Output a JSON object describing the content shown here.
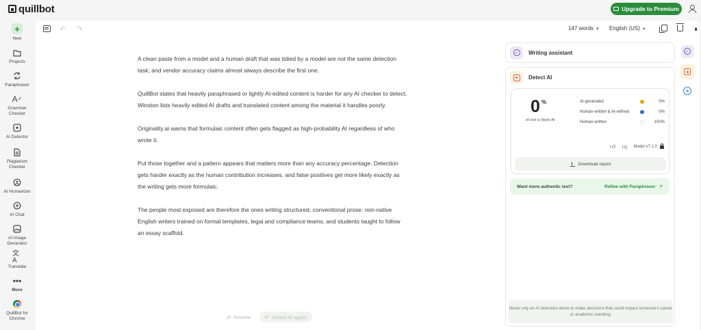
{
  "header": {
    "logo_text": "quillbot",
    "upgrade_label": "Upgrade to Premium",
    "brand_color": "#2a8c3c"
  },
  "sidebar": {
    "items": [
      {
        "label": "New",
        "icon": "plus-icon"
      },
      {
        "label": "Projects",
        "icon": "folder-icon"
      },
      {
        "label": "Paraphraser",
        "icon": "paraphraser-icon"
      },
      {
        "label": "Grammar Checker",
        "icon": "grammar-icon"
      },
      {
        "label": "AI Detector",
        "icon": "ai-detector-icon"
      },
      {
        "label": "Plagiarism Checker",
        "icon": "plagiarism-icon"
      },
      {
        "label": "AI Humanizer",
        "icon": "humanizer-icon"
      },
      {
        "label": "AI Chat",
        "icon": "chat-icon"
      },
      {
        "label": "AI Image Generator",
        "icon": "image-generator-icon"
      },
      {
        "label": "Translate",
        "icon": "translate-icon"
      },
      {
        "label": "More",
        "icon": "more-dots-icon"
      },
      {
        "label": "QuillBot for Chrome",
        "icon": "chrome-icon"
      }
    ]
  },
  "toolbar": {
    "word_count": "147 words",
    "language": "English (US)"
  },
  "editor": {
    "paragraphs": [
      "A clean paste from a model and a human draft that was tidied by a model are not the same detection task, and vendor accuracy claims almost always describe the first one.",
      "QuillBot states that heavily paraphrased or lightly AI-edited content is harder for any AI checker to detect. Winston lists heavily edited AI drafts and translated content among the material it handles poorly.",
      "Originality.ai warns that formulaic content often gets flagged as high-probability AI regardless of who wrote it.",
      "Put those together and a pattern appears that matters more than any accuracy percentage. Detection gets harder exactly as the human contribution increases, and false positives get more likely exactly as the writing gets more formulaic.",
      "The people most exposed are therefore the ones writing structured, conventional prose: non-native English writers trained on formal templates, legal and compliance teams, and students taught to follow an essay scaffold."
    ]
  },
  "actions": {
    "rewrite_label": "Rewrite",
    "detect_again_label": "Detect AI again"
  },
  "assistant_panel": {
    "writing_assistant_title": "Writing assistant",
    "detect_ai_title": "Detect AI",
    "score": {
      "value": "0",
      "unit": "%",
      "caption": "of text is likely AI"
    },
    "metrics": [
      {
        "label": "AI-generated",
        "value": "0%",
        "color": "#e0a800"
      },
      {
        "label": "Human-written & AI-refined",
        "value": "0%",
        "color": "#2a6fd1"
      },
      {
        "label": "Human-written",
        "value": "100%",
        "color": "#ffffff"
      }
    ],
    "model_version": "Model v7.1.0",
    "download_label": "Download report",
    "refine_question": "Want more authentic text?",
    "refine_link": "Refine with Paraphraser",
    "disclaimer": "Never rely on AI detection alone to make decisions that could impact someone's career or academic standing."
  }
}
